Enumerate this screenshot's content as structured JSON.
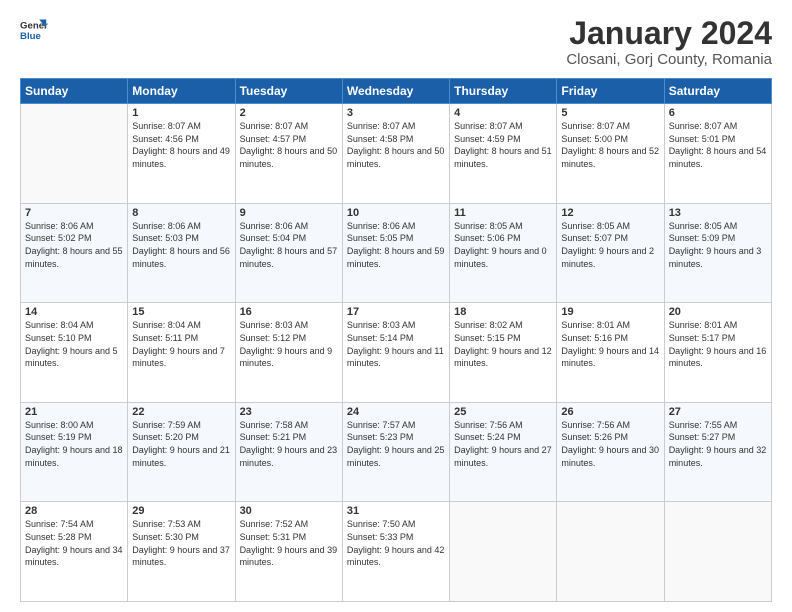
{
  "logo": {
    "general": "General",
    "blue": "Blue"
  },
  "title": "January 2024",
  "subtitle": "Closani, Gorj County, Romania",
  "days_header": [
    "Sunday",
    "Monday",
    "Tuesday",
    "Wednesday",
    "Thursday",
    "Friday",
    "Saturday"
  ],
  "weeks": [
    [
      {
        "day": "",
        "sunrise": "",
        "sunset": "",
        "daylight": "",
        "empty": true
      },
      {
        "day": "1",
        "sunrise": "Sunrise: 8:07 AM",
        "sunset": "Sunset: 4:56 PM",
        "daylight": "Daylight: 8 hours and 49 minutes."
      },
      {
        "day": "2",
        "sunrise": "Sunrise: 8:07 AM",
        "sunset": "Sunset: 4:57 PM",
        "daylight": "Daylight: 8 hours and 50 minutes."
      },
      {
        "day": "3",
        "sunrise": "Sunrise: 8:07 AM",
        "sunset": "Sunset: 4:58 PM",
        "daylight": "Daylight: 8 hours and 50 minutes."
      },
      {
        "day": "4",
        "sunrise": "Sunrise: 8:07 AM",
        "sunset": "Sunset: 4:59 PM",
        "daylight": "Daylight: 8 hours and 51 minutes."
      },
      {
        "day": "5",
        "sunrise": "Sunrise: 8:07 AM",
        "sunset": "Sunset: 5:00 PM",
        "daylight": "Daylight: 8 hours and 52 minutes."
      },
      {
        "day": "6",
        "sunrise": "Sunrise: 8:07 AM",
        "sunset": "Sunset: 5:01 PM",
        "daylight": "Daylight: 8 hours and 54 minutes."
      }
    ],
    [
      {
        "day": "7",
        "sunrise": "Sunrise: 8:06 AM",
        "sunset": "Sunset: 5:02 PM",
        "daylight": "Daylight: 8 hours and 55 minutes."
      },
      {
        "day": "8",
        "sunrise": "Sunrise: 8:06 AM",
        "sunset": "Sunset: 5:03 PM",
        "daylight": "Daylight: 8 hours and 56 minutes."
      },
      {
        "day": "9",
        "sunrise": "Sunrise: 8:06 AM",
        "sunset": "Sunset: 5:04 PM",
        "daylight": "Daylight: 8 hours and 57 minutes."
      },
      {
        "day": "10",
        "sunrise": "Sunrise: 8:06 AM",
        "sunset": "Sunset: 5:05 PM",
        "daylight": "Daylight: 8 hours and 59 minutes."
      },
      {
        "day": "11",
        "sunrise": "Sunrise: 8:05 AM",
        "sunset": "Sunset: 5:06 PM",
        "daylight": "Daylight: 9 hours and 0 minutes."
      },
      {
        "day": "12",
        "sunrise": "Sunrise: 8:05 AM",
        "sunset": "Sunset: 5:07 PM",
        "daylight": "Daylight: 9 hours and 2 minutes."
      },
      {
        "day": "13",
        "sunrise": "Sunrise: 8:05 AM",
        "sunset": "Sunset: 5:09 PM",
        "daylight": "Daylight: 9 hours and 3 minutes."
      }
    ],
    [
      {
        "day": "14",
        "sunrise": "Sunrise: 8:04 AM",
        "sunset": "Sunset: 5:10 PM",
        "daylight": "Daylight: 9 hours and 5 minutes."
      },
      {
        "day": "15",
        "sunrise": "Sunrise: 8:04 AM",
        "sunset": "Sunset: 5:11 PM",
        "daylight": "Daylight: 9 hours and 7 minutes."
      },
      {
        "day": "16",
        "sunrise": "Sunrise: 8:03 AM",
        "sunset": "Sunset: 5:12 PM",
        "daylight": "Daylight: 9 hours and 9 minutes."
      },
      {
        "day": "17",
        "sunrise": "Sunrise: 8:03 AM",
        "sunset": "Sunset: 5:14 PM",
        "daylight": "Daylight: 9 hours and 11 minutes."
      },
      {
        "day": "18",
        "sunrise": "Sunrise: 8:02 AM",
        "sunset": "Sunset: 5:15 PM",
        "daylight": "Daylight: 9 hours and 12 minutes."
      },
      {
        "day": "19",
        "sunrise": "Sunrise: 8:01 AM",
        "sunset": "Sunset: 5:16 PM",
        "daylight": "Daylight: 9 hours and 14 minutes."
      },
      {
        "day": "20",
        "sunrise": "Sunrise: 8:01 AM",
        "sunset": "Sunset: 5:17 PM",
        "daylight": "Daylight: 9 hours and 16 minutes."
      }
    ],
    [
      {
        "day": "21",
        "sunrise": "Sunrise: 8:00 AM",
        "sunset": "Sunset: 5:19 PM",
        "daylight": "Daylight: 9 hours and 18 minutes."
      },
      {
        "day": "22",
        "sunrise": "Sunrise: 7:59 AM",
        "sunset": "Sunset: 5:20 PM",
        "daylight": "Daylight: 9 hours and 21 minutes."
      },
      {
        "day": "23",
        "sunrise": "Sunrise: 7:58 AM",
        "sunset": "Sunset: 5:21 PM",
        "daylight": "Daylight: 9 hours and 23 minutes."
      },
      {
        "day": "24",
        "sunrise": "Sunrise: 7:57 AM",
        "sunset": "Sunset: 5:23 PM",
        "daylight": "Daylight: 9 hours and 25 minutes."
      },
      {
        "day": "25",
        "sunrise": "Sunrise: 7:56 AM",
        "sunset": "Sunset: 5:24 PM",
        "daylight": "Daylight: 9 hours and 27 minutes."
      },
      {
        "day": "26",
        "sunrise": "Sunrise: 7:56 AM",
        "sunset": "Sunset: 5:26 PM",
        "daylight": "Daylight: 9 hours and 30 minutes."
      },
      {
        "day": "27",
        "sunrise": "Sunrise: 7:55 AM",
        "sunset": "Sunset: 5:27 PM",
        "daylight": "Daylight: 9 hours and 32 minutes."
      }
    ],
    [
      {
        "day": "28",
        "sunrise": "Sunrise: 7:54 AM",
        "sunset": "Sunset: 5:28 PM",
        "daylight": "Daylight: 9 hours and 34 minutes."
      },
      {
        "day": "29",
        "sunrise": "Sunrise: 7:53 AM",
        "sunset": "Sunset: 5:30 PM",
        "daylight": "Daylight: 9 hours and 37 minutes."
      },
      {
        "day": "30",
        "sunrise": "Sunrise: 7:52 AM",
        "sunset": "Sunset: 5:31 PM",
        "daylight": "Daylight: 9 hours and 39 minutes."
      },
      {
        "day": "31",
        "sunrise": "Sunrise: 7:50 AM",
        "sunset": "Sunset: 5:33 PM",
        "daylight": "Daylight: 9 hours and 42 minutes."
      },
      {
        "day": "",
        "sunrise": "",
        "sunset": "",
        "daylight": "",
        "empty": true
      },
      {
        "day": "",
        "sunrise": "",
        "sunset": "",
        "daylight": "",
        "empty": true
      },
      {
        "day": "",
        "sunrise": "",
        "sunset": "",
        "daylight": "",
        "empty": true
      }
    ]
  ]
}
